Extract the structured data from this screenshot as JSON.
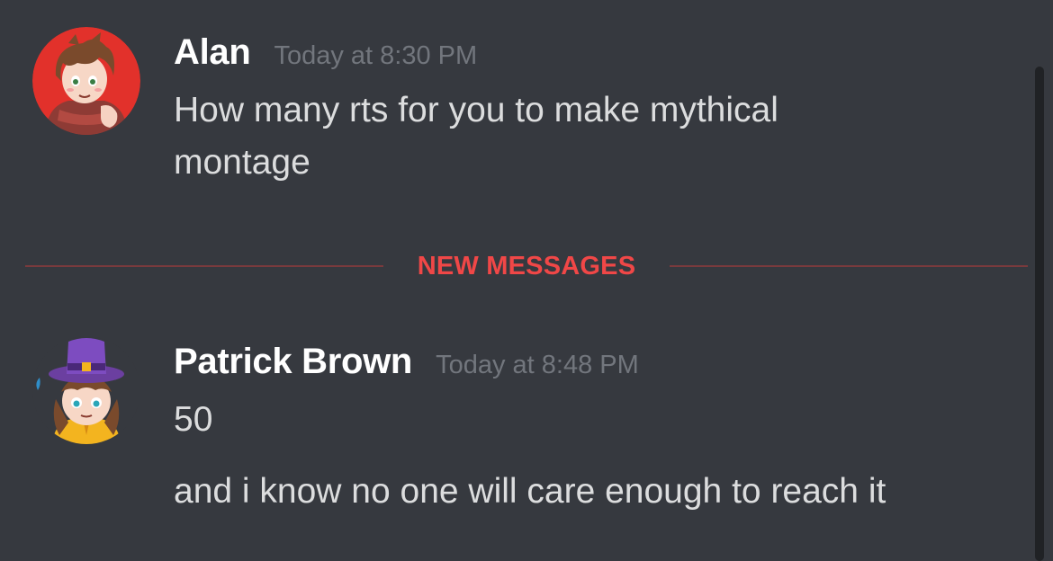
{
  "messages": [
    {
      "username": "Alan",
      "timestamp": "Today at 8:30 PM",
      "avatar": "red-haired-boy-avatar",
      "lines": [
        "How many rts for you to make mythical",
        "montage"
      ]
    },
    {
      "username": "Patrick Brown",
      "timestamp": "Today at 8:48 PM",
      "avatar": "purple-hat-girl-avatar",
      "lines": [
        "50",
        "and i know no one will care enough to reach it"
      ]
    }
  ],
  "divider": {
    "label": "NEW MESSAGES"
  },
  "colors": {
    "background": "#36393f",
    "username": "#ffffff",
    "timestamp": "#72767d",
    "message_text": "#dcddde",
    "new_messages": "#f04747"
  }
}
